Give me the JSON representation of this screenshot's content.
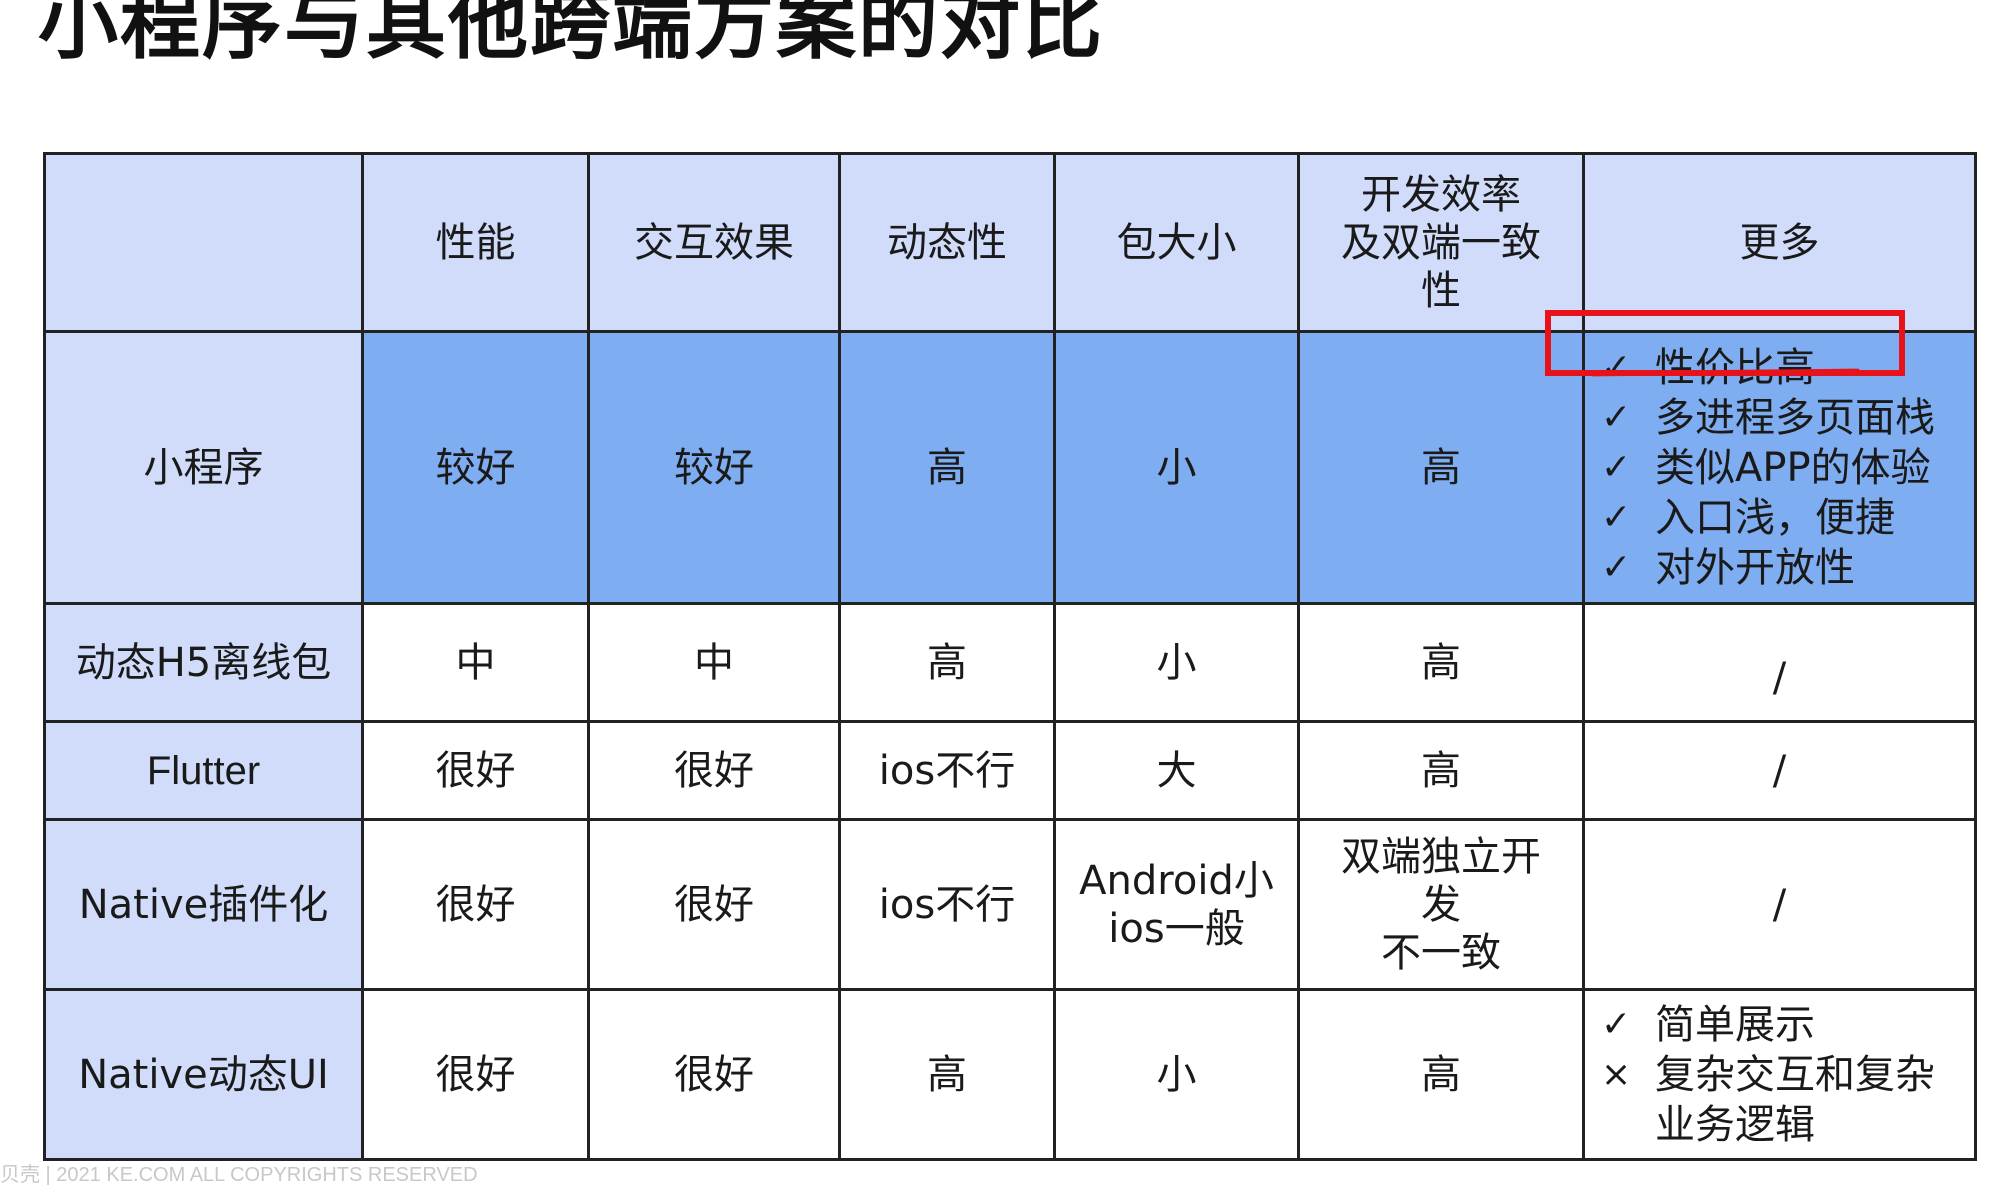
{
  "title": "小程序与其他跨端方案的对比",
  "table": {
    "headers": [
      "",
      "性能",
      "交互效果",
      "动态性",
      "包大小",
      "开发效率\n及双端一致\n性",
      "更多"
    ],
    "rows": [
      {
        "label": "小程序",
        "cells": [
          "较好",
          "较好",
          "高",
          "小",
          "高"
        ],
        "more": [
          {
            "mark": "✓",
            "text": "性价比高"
          },
          {
            "mark": "✓",
            "text": "多进程多页面栈"
          },
          {
            "mark": "✓",
            "text": "类似APP的体验"
          },
          {
            "mark": "✓",
            "text": "入口浅，便捷"
          },
          {
            "mark": "✓",
            "text": "对外开放性"
          }
        ]
      },
      {
        "label": "动态H5离线包",
        "cells": [
          "中",
          "中",
          "高",
          "小",
          "高"
        ],
        "more_text": "/"
      },
      {
        "label": "Flutter",
        "cells": [
          "很好",
          "很好",
          "ios不行",
          "大",
          "高"
        ],
        "more_text": "/"
      },
      {
        "label": "Native插件化",
        "cells": [
          "很好",
          "很好",
          "ios不行",
          "Android小\nios一般",
          "双端独立开\n发\n不一致"
        ],
        "more_text": "/"
      },
      {
        "label": "Native动态UI",
        "cells": [
          "很好",
          "很好",
          "高",
          "小",
          "高"
        ],
        "more": [
          {
            "mark": "✓",
            "text": "简单展示"
          },
          {
            "mark": "×",
            "text": "复杂交互和复杂业务逻辑"
          }
        ]
      }
    ]
  },
  "footer": "贝壳 | 2021 KE.COM ALL COPYRIGHTS RESERVED",
  "colors": {
    "header_bg": "#d0dcf9",
    "highlight_row_bg": "#7fadf1",
    "annotation_red": "#e8121a"
  }
}
